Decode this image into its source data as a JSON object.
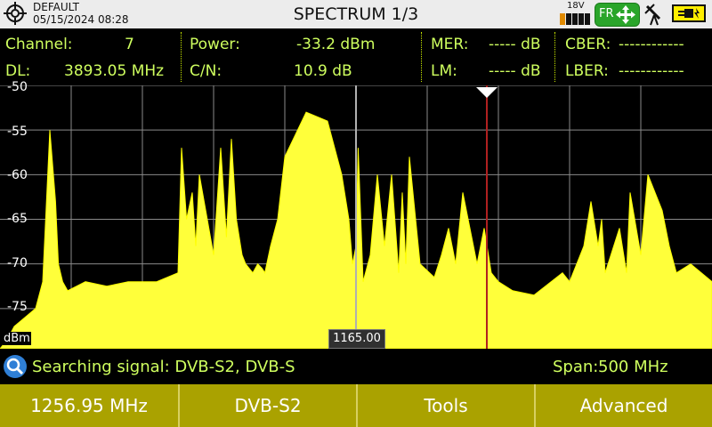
{
  "header": {
    "profile": "DEFAULT",
    "datetime": "05/15/2024 08:28",
    "title": "SPECTRUM 1/3",
    "voltage": "18V",
    "fr_label": "FR"
  },
  "measurements": {
    "channel_label": "Channel:",
    "channel_value": "7",
    "dl_label": "DL:",
    "dl_value": "3893.05 MHz",
    "power_label": "Power:",
    "power_value": "-33.2 dBm",
    "cn_label": "C/N:",
    "cn_value": "10.9 dB",
    "mer_label": "MER:",
    "mer_value": "----- dB",
    "lm_label": "LM:",
    "lm_value": "----- dB",
    "cber_label": "CBER:",
    "cber_value": "------------",
    "lber_label": "LBER:",
    "lber_value": "------------"
  },
  "chart_data": {
    "type": "area",
    "ylabel": "dBm",
    "y_ticks": [
      "-50",
      "-55",
      "-60",
      "-65",
      "-70",
      "-75"
    ],
    "ylim": [
      -79.5,
      -50
    ],
    "grid": true,
    "cursor_label": "1165.00",
    "x": [
      0.0,
      0.01,
      0.02,
      0.05,
      0.06,
      0.07,
      0.078,
      0.082,
      0.088,
      0.095,
      0.12,
      0.15,
      0.18,
      0.22,
      0.25,
      0.255,
      0.262,
      0.27,
      0.275,
      0.28,
      0.3,
      0.31,
      0.318,
      0.325,
      0.332,
      0.34,
      0.345,
      0.355,
      0.362,
      0.368,
      0.372,
      0.38,
      0.39,
      0.4,
      0.43,
      0.46,
      0.48,
      0.49,
      0.495,
      0.5,
      0.503,
      0.51,
      0.52,
      0.53,
      0.54,
      0.55,
      0.56,
      0.565,
      0.57,
      0.575,
      0.59,
      0.61,
      0.62,
      0.63,
      0.64,
      0.65,
      0.67,
      0.68,
      0.69,
      0.7,
      0.72,
      0.75,
      0.79,
      0.8,
      0.82,
      0.83,
      0.84,
      0.845,
      0.85,
      0.87,
      0.88,
      0.885,
      0.9,
      0.91,
      0.93,
      0.94,
      0.95,
      0.97,
      1.0
    ],
    "y": [
      -79.5,
      -78.5,
      -77.0,
      -75.0,
      -72.0,
      -55.0,
      -63.0,
      -70.0,
      -72.0,
      -73.0,
      -72.0,
      -72.5,
      -72.0,
      -72.0,
      -71.0,
      -57.0,
      -65.0,
      -62.0,
      -68.0,
      -60.0,
      -69.0,
      -57.0,
      -67.0,
      -56.0,
      -65.0,
      -69.0,
      -70.0,
      -71.0,
      -70.0,
      -70.5,
      -71.0,
      -68.0,
      -65.0,
      -58.0,
      -53.0,
      -54.0,
      -60.0,
      -65.0,
      -70.0,
      -68.0,
      -57.0,
      -72.0,
      -69.0,
      -60.0,
      -68.0,
      -60.0,
      -71.0,
      -62.0,
      -70.0,
      -58.0,
      -70.0,
      -71.5,
      -69.0,
      -66.0,
      -70.0,
      -62.0,
      -70.0,
      -66.0,
      -71.0,
      -72.0,
      -73.0,
      -73.5,
      -71.0,
      -72.0,
      -68.0,
      -63.0,
      -68.0,
      -65.0,
      -71.0,
      -66.0,
      -71.0,
      -62.0,
      -69.0,
      -60.0,
      -64.0,
      -68.0,
      -71.0,
      -70.0,
      -72.0
    ]
  },
  "status": {
    "text": "Searching signal: DVB-S2, DVB-S",
    "span_label": "Span:",
    "span_value": "500 MHz"
  },
  "softkeys": [
    "1256.95 MHz",
    "DVB-S2",
    "Tools",
    "Advanced"
  ],
  "colors": {
    "accent_text": "#cfff5f",
    "trace": "#ffff3a",
    "softkey_bar": "#aaa200",
    "marker_line": "#b02020",
    "fr_button": "#2aa52a"
  }
}
